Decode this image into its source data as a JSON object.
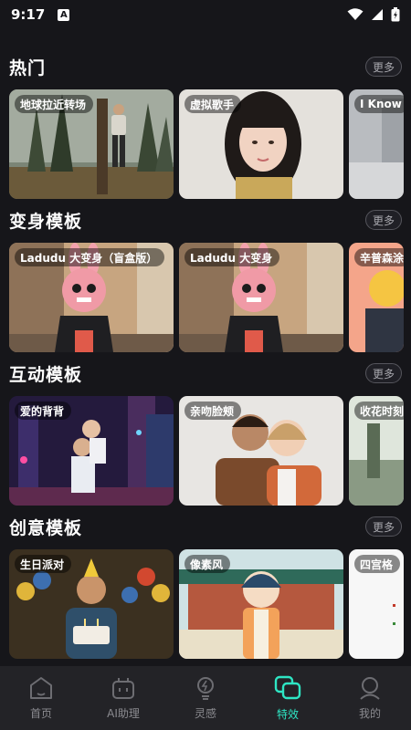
{
  "status": {
    "time": "9:17",
    "badge": "A"
  },
  "sections": [
    {
      "title": "热门",
      "more": "更多",
      "cards": [
        {
          "label": "地球拉近转场"
        },
        {
          "label": "虚拟歌手"
        },
        {
          "label": "I Know"
        }
      ]
    },
    {
      "title": "变身模板",
      "more": "更多",
      "cards": [
        {
          "label": "Ladudu 大变身（盲盒版）"
        },
        {
          "label": "Ladudu 大变身"
        },
        {
          "label": "辛普森涂"
        }
      ]
    },
    {
      "title": "互动模板",
      "more": "更多",
      "cards": [
        {
          "label": "爱的背背"
        },
        {
          "label": "亲吻脸颊"
        },
        {
          "label": "收花时刻"
        }
      ]
    },
    {
      "title": "创意模板",
      "more": "更多",
      "cards": [
        {
          "label": "生日派对"
        },
        {
          "label": "像素风"
        },
        {
          "label": "四宫格"
        }
      ]
    }
  ],
  "nav": [
    {
      "label": "首页",
      "icon": "home-icon"
    },
    {
      "label": "AI助理",
      "icon": "robot-icon"
    },
    {
      "label": "灵感",
      "icon": "bulb-icon"
    },
    {
      "label": "特效",
      "icon": "effects-icon",
      "active": true
    },
    {
      "label": "我的",
      "icon": "profile-icon"
    }
  ],
  "colors": {
    "accent": "#2ee6c4",
    "background": "#16161a",
    "nav_background": "#232327"
  }
}
